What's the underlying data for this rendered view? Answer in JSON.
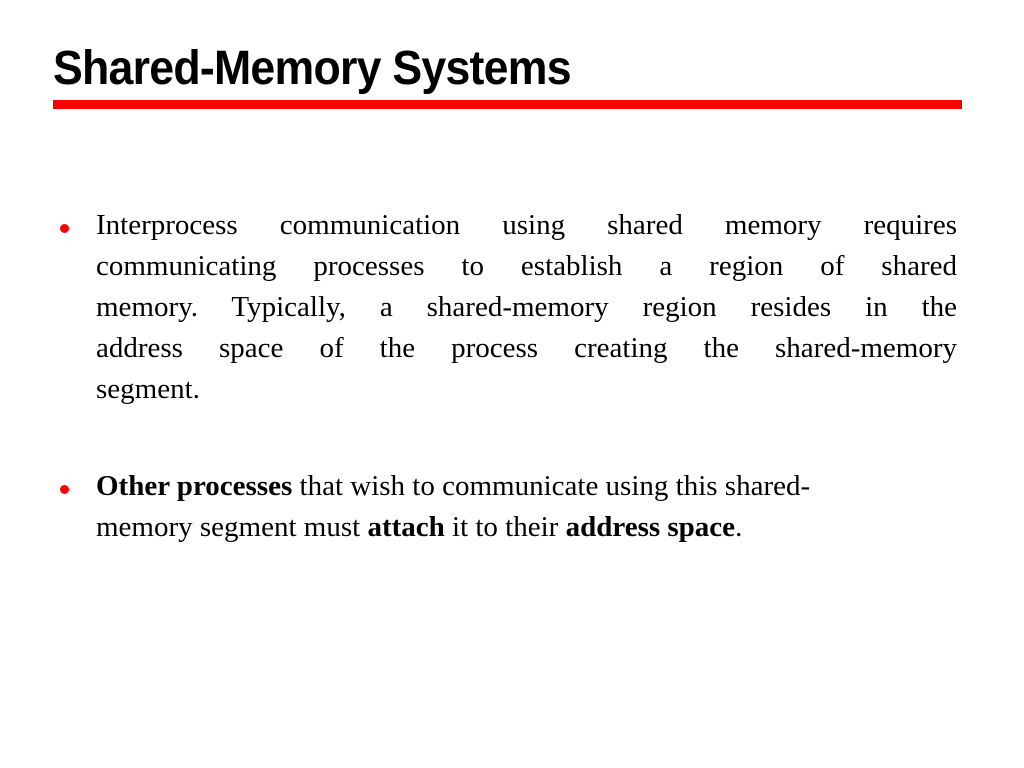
{
  "slide": {
    "background_color": "#ffffff",
    "title": "Shared-Memory Systems",
    "title_color": "#000000",
    "rule_color": "#ff0000",
    "bullet_color": "#ff0000",
    "body_color": "#000000"
  },
  "bullets": [
    {
      "id": "bullet-interprocess-communication",
      "marker": "red-dot",
      "alignment": "justified",
      "full_text": "Interprocess communication using shared memory requires communicating processes to establish a region of shared memory. Typically, a shared-memory region resides in the address space of the process creating the shared-memory segment.",
      "lines": [
        "Interprocess communication using shared memory requires",
        "communicating processes to establish a region of shared",
        "memory. Typically, a shared-memory region resides in the",
        "address space of the process creating the shared-memory",
        "segment."
      ]
    },
    {
      "id": "bullet-other-processes-attach",
      "marker": "red-dot",
      "alignment": "left",
      "full_text": "Other processes that wish to communicate using this shared-memory segment must attach it to their address space.",
      "line1": {
        "bold_lead": "Other processes",
        "rest": " that wish to communicate using this shared-"
      },
      "line2": {
        "pre_attach": "memory segment must ",
        "bold_attach": "attach",
        "mid": " it to their ",
        "bold_address_space": "address space",
        "period": "."
      }
    }
  ]
}
